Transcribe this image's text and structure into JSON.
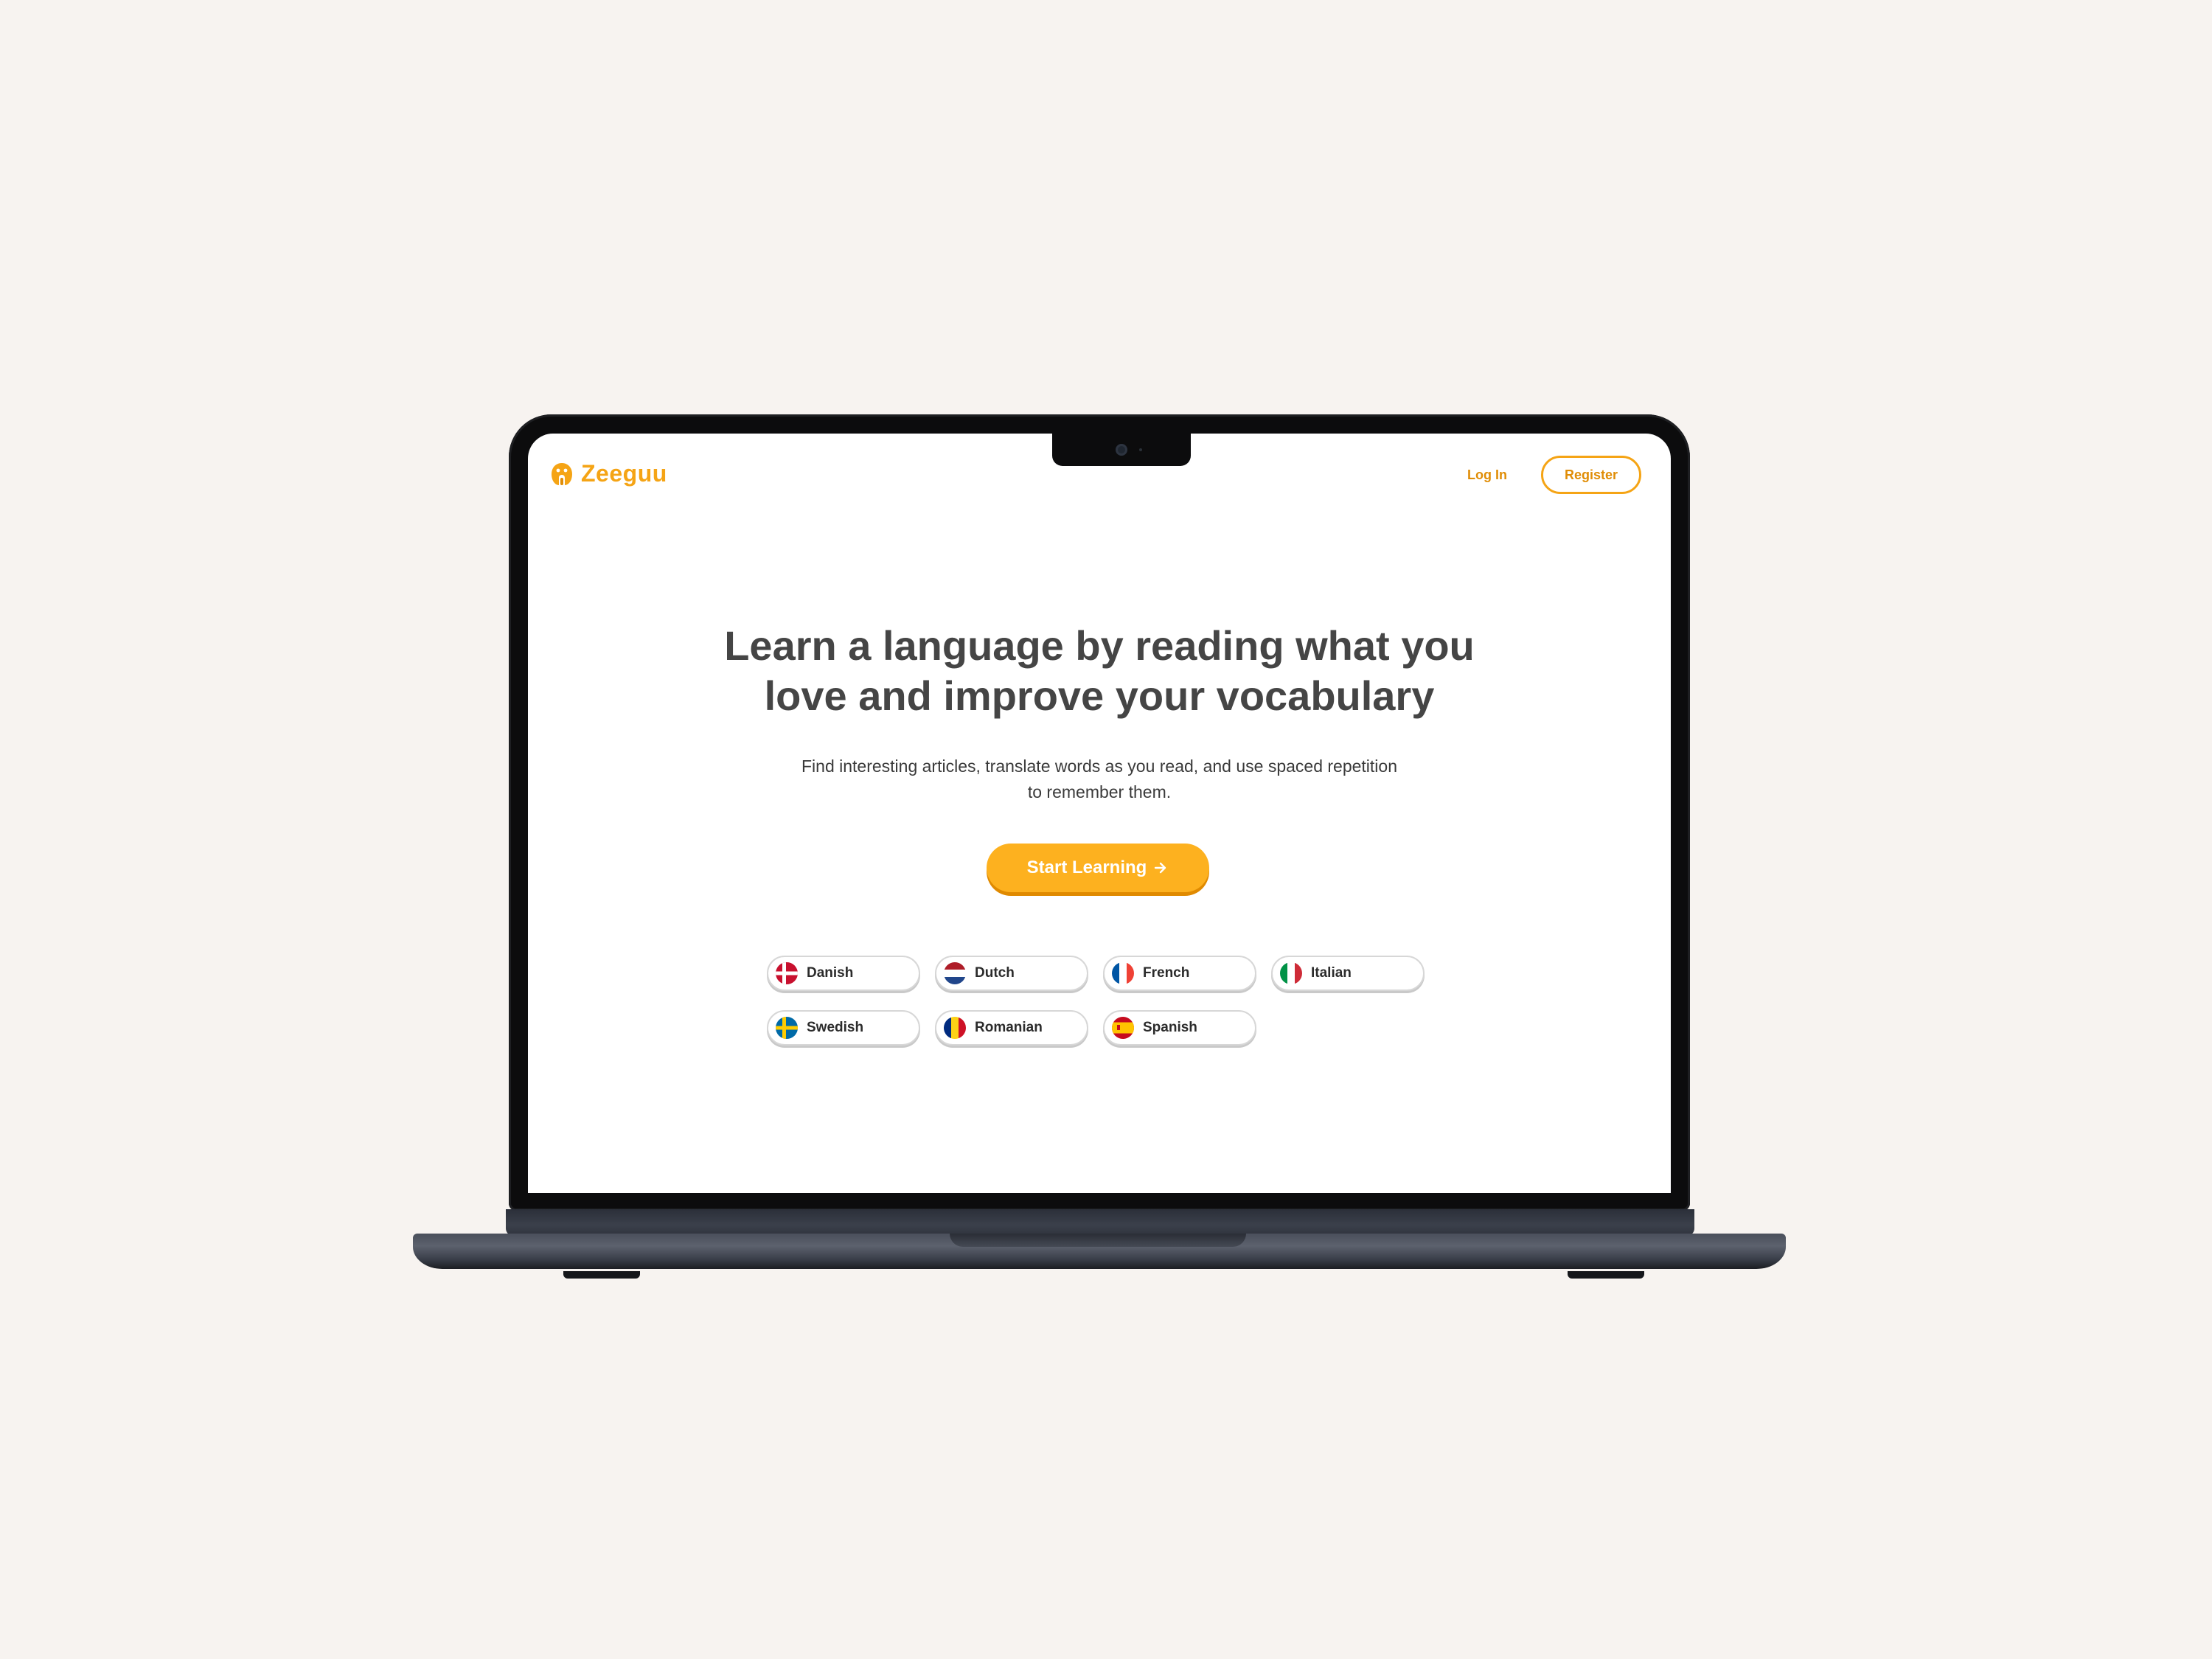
{
  "header": {
    "brand_name": "Zeeguu",
    "login_label": "Log In",
    "register_label": "Register"
  },
  "hero": {
    "title_line_1": "Learn a language by reading what you",
    "title_line_2": "love and improve your vocabulary",
    "subtitle_line_1": "Find interesting articles, translate words as you read, and use spaced repetition",
    "subtitle_line_2": "to remember them.",
    "cta_label": "Start Learning",
    "cta_icon": "arrow-right-icon"
  },
  "languages": [
    {
      "label": "Danish",
      "flag": "denmark-flag-icon"
    },
    {
      "label": "Dutch",
      "flag": "netherlands-flag-icon"
    },
    {
      "label": "French",
      "flag": "france-flag-icon"
    },
    {
      "label": "Italian",
      "flag": "italy-flag-icon"
    },
    {
      "label": "Swedish",
      "flag": "sweden-flag-icon"
    },
    {
      "label": "Romanian",
      "flag": "romania-flag-icon"
    },
    {
      "label": "Spanish",
      "flag": "spain-flag-icon"
    }
  ],
  "colors": {
    "accent": "#f5a415",
    "cta_background": "#fdb11f",
    "title_text": "#454545",
    "background": "#f7f3f0"
  }
}
